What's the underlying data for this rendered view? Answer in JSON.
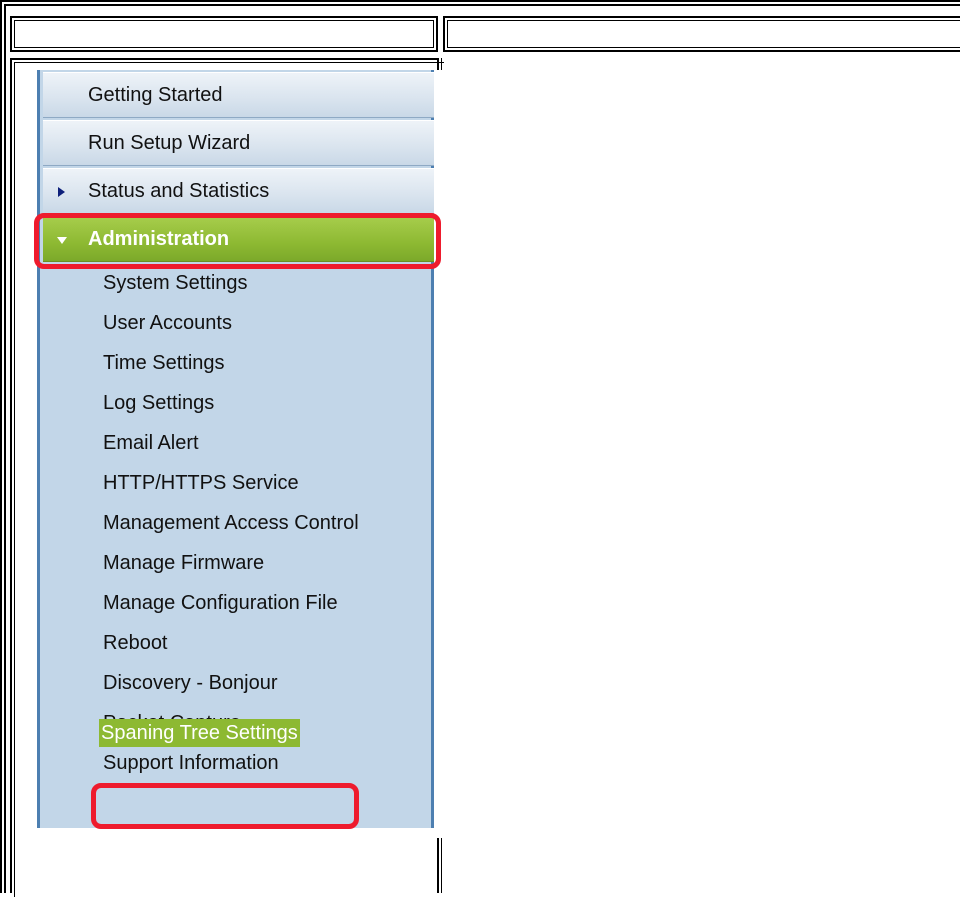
{
  "nav": {
    "top_items": [
      {
        "label": "Getting Started",
        "has_arrow": false
      },
      {
        "label": "Run Setup Wizard",
        "has_arrow": false
      },
      {
        "label": "Status and Statistics",
        "has_arrow": true,
        "expanded": false
      }
    ],
    "administration": {
      "label": "Administration",
      "expanded": true,
      "highlighted": true
    },
    "sub_items": [
      {
        "label": "System Settings"
      },
      {
        "label": "User Accounts"
      },
      {
        "label": "Time Settings"
      },
      {
        "label": "Log Settings"
      },
      {
        "label": "Email Alert"
      },
      {
        "label": "HTTP/HTTPS Service"
      },
      {
        "label": "Management Access Control"
      },
      {
        "label": "Manage Firmware"
      },
      {
        "label": "Manage Configuration File"
      },
      {
        "label": "Reboot"
      },
      {
        "label": "Discovery - Bonjour"
      },
      {
        "label": "Packet Capture"
      },
      {
        "label": "Support Information"
      },
      {
        "label": "Spaning Tree Settings",
        "selected": true,
        "highlighted": true
      }
    ]
  },
  "colors": {
    "nav_background": "#c2d6e8",
    "active_green": "#8db932",
    "highlight_red": "#ee1b2d",
    "nav_border_blue": "#4d7fb1"
  }
}
